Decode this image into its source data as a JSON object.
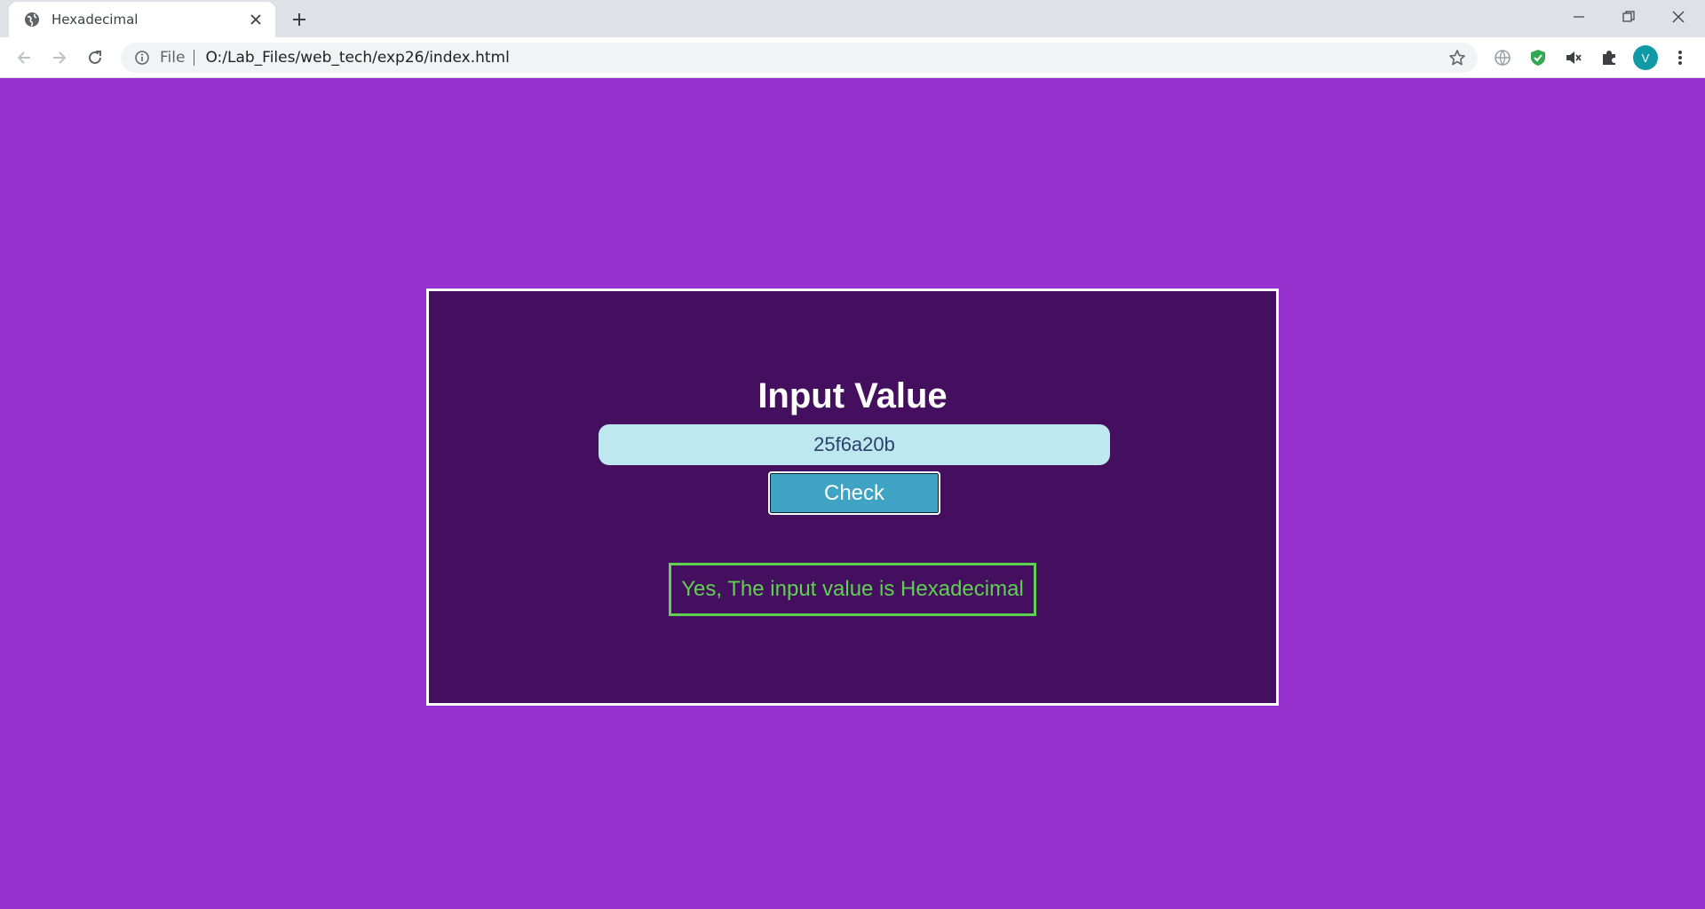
{
  "browser": {
    "tab_title": "Hexadecimal",
    "omnibox_scheme_label": "File",
    "url": "O:/Lab_Files/web_tech/exp26/index.html",
    "profile_initial": "V",
    "extension_icons": [
      "globe-extension-icon",
      "shield-extension-icon",
      "mute-icon",
      "puzzle-extensions-icon"
    ],
    "colors": {
      "tabbar": "#dee1e6",
      "avatar": "#0f9aa5"
    }
  },
  "page": {
    "heading": "Input Value",
    "input_value": "25f6a20b",
    "check_button_label": "Check",
    "result_message": "Yes, The input value is Hexadecimal",
    "colors": {
      "background": "#9631cd",
      "card": "#450f60",
      "input": "#bde8f0",
      "button": "#3fa3c4",
      "result": "#5fd150"
    }
  }
}
